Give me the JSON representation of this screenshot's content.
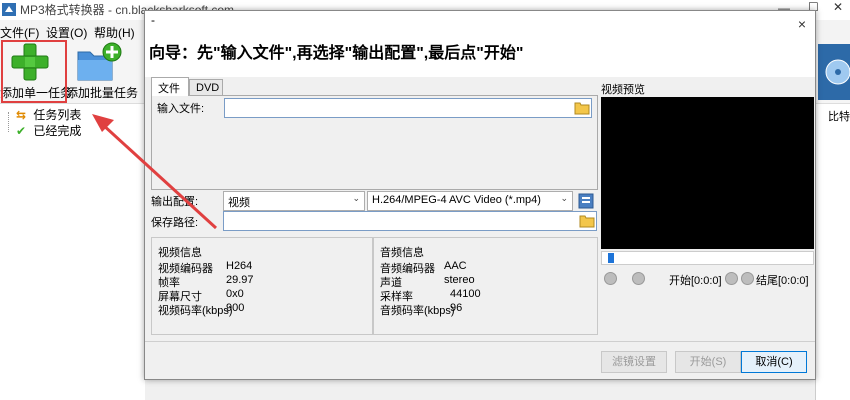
{
  "window": {
    "title": "MP3格式转换器 - cn.blacksharksoft.com"
  },
  "menu": {
    "items": [
      "文件(F)",
      "设置(O)",
      "帮助(H)"
    ]
  },
  "toolbar": {
    "add_single": "添加单一任务",
    "add_batch": "添加批量任务"
  },
  "tree": {
    "items": [
      "任务列表",
      "已经完成"
    ]
  },
  "side": {
    "partial_label": "比特"
  },
  "dialog": {
    "title_mark": "-",
    "close": "×",
    "wizard_text": "向导：先\"输入文件\",再选择\"输出配置\",最后点\"开始\"",
    "tabs": [
      "文件",
      "DVD"
    ],
    "input_file_label": "输入文件:",
    "input_file_value": "",
    "output_config_label": "输出配置:",
    "output_format": "视频",
    "output_codec": "H.264/MPEG-4 AVC Video (*.mp4)",
    "save_path_label": "保存路径:",
    "save_path_value": "",
    "preview_label": "视频预览",
    "start_time_label": "开始[0:0:0]",
    "end_time_label": "结尾[0:0:0]",
    "video_info": {
      "title": "视频信息",
      "rows": [
        {
          "k": "视频编码器",
          "v": "H264"
        },
        {
          "k": "帧率",
          "v": "29.97"
        },
        {
          "k": "屏幕尺寸",
          "v": "0x0"
        },
        {
          "k": "视频码率(kbps)",
          "v": "900"
        }
      ]
    },
    "audio_info": {
      "title": "音频信息",
      "rows": [
        {
          "k": "音频编码器",
          "v": "AAC"
        },
        {
          "k": "声道",
          "v": "stereo"
        },
        {
          "k": "采样率",
          "v": "44100"
        },
        {
          "k": "音频码率(kbps)",
          "v": "96"
        }
      ]
    },
    "buttons": {
      "filter": "滤镜设置",
      "start": "开始(S)",
      "cancel": "取消(C)"
    }
  },
  "colors": {
    "accent": "#e04040",
    "preview_bg": "#000000",
    "add_green": "#3db02a",
    "folder_blue": "#4a90d9"
  },
  "icons": [
    "plus-icon",
    "folder-add-icon",
    "tasklist-icon",
    "check-icon",
    "folder-browse-icon",
    "settings-icon",
    "pause-icon",
    "stop-icon",
    "arrow-annotation"
  ]
}
